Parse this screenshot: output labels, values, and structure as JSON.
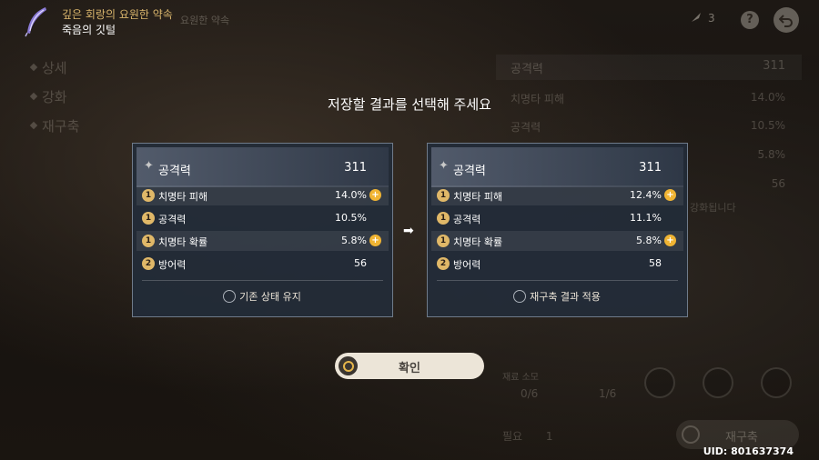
{
  "header": {
    "title": "깊은 회랑의 요원한 약속",
    "subtitle": "죽음의 깃털",
    "ghost_title": "요원한 약속",
    "resource_count": "3",
    "help_label": "?",
    "icons": [
      "feather-icon",
      "resource-icon",
      "help-icon",
      "back-icon"
    ]
  },
  "nav": {
    "items": [
      {
        "label": "상세"
      },
      {
        "label": "강화"
      },
      {
        "label": "재구축"
      }
    ]
  },
  "background_panel": {
    "main": {
      "label": "공격력",
      "value": "311"
    },
    "subs": [
      {
        "label": "치명타 피해",
        "value": "14.0%"
      },
      {
        "label": "공격력",
        "value": "10.5%"
      },
      {
        "label": "",
        "value": "5.8%"
      },
      {
        "label": "",
        "value": "56"
      }
    ],
    "hint": "강화됩니다",
    "cost_label": "재료 소모",
    "cost_a": "0/6",
    "cost_b": "1/6",
    "need_label": "필요",
    "need_count": "1",
    "rebuild_button": "재구축"
  },
  "dialog": {
    "prompt": "저장할 결과를 선택해 주세요",
    "arrow": "➡",
    "confirm_label": "확인",
    "before": {
      "main": {
        "label": "공격력",
        "value": "311"
      },
      "subs": [
        {
          "badge": "1",
          "label": "치명타 피해",
          "value": "14.0%",
          "bonus": true
        },
        {
          "badge": "1",
          "label": "공격력",
          "value": "10.5%",
          "bonus": false
        },
        {
          "badge": "1",
          "label": "치명타 확률",
          "value": "5.8%",
          "bonus": true
        },
        {
          "badge": "2",
          "label": "방어력",
          "value": "56",
          "bonus": false
        }
      ],
      "choice_label": "기존 상태 유지"
    },
    "after": {
      "main": {
        "label": "공격력",
        "value": "311"
      },
      "subs": [
        {
          "badge": "1",
          "label": "치명타 피해",
          "value": "12.4%",
          "bonus": true
        },
        {
          "badge": "1",
          "label": "공격력",
          "value": "11.1%",
          "bonus": false
        },
        {
          "badge": "1",
          "label": "치명타 확률",
          "value": "5.8%",
          "bonus": true
        },
        {
          "badge": "2",
          "label": "방어력",
          "value": "58",
          "bonus": false
        }
      ],
      "choice_label": "재구축 결과 적용"
    }
  },
  "uid": "UID: 801637374",
  "colors": {
    "accent_gold": "#d9b56c",
    "bonus_orange": "#f0b433",
    "card_border": "#6f7b8a",
    "confirm_bg": "#ece5d8"
  }
}
